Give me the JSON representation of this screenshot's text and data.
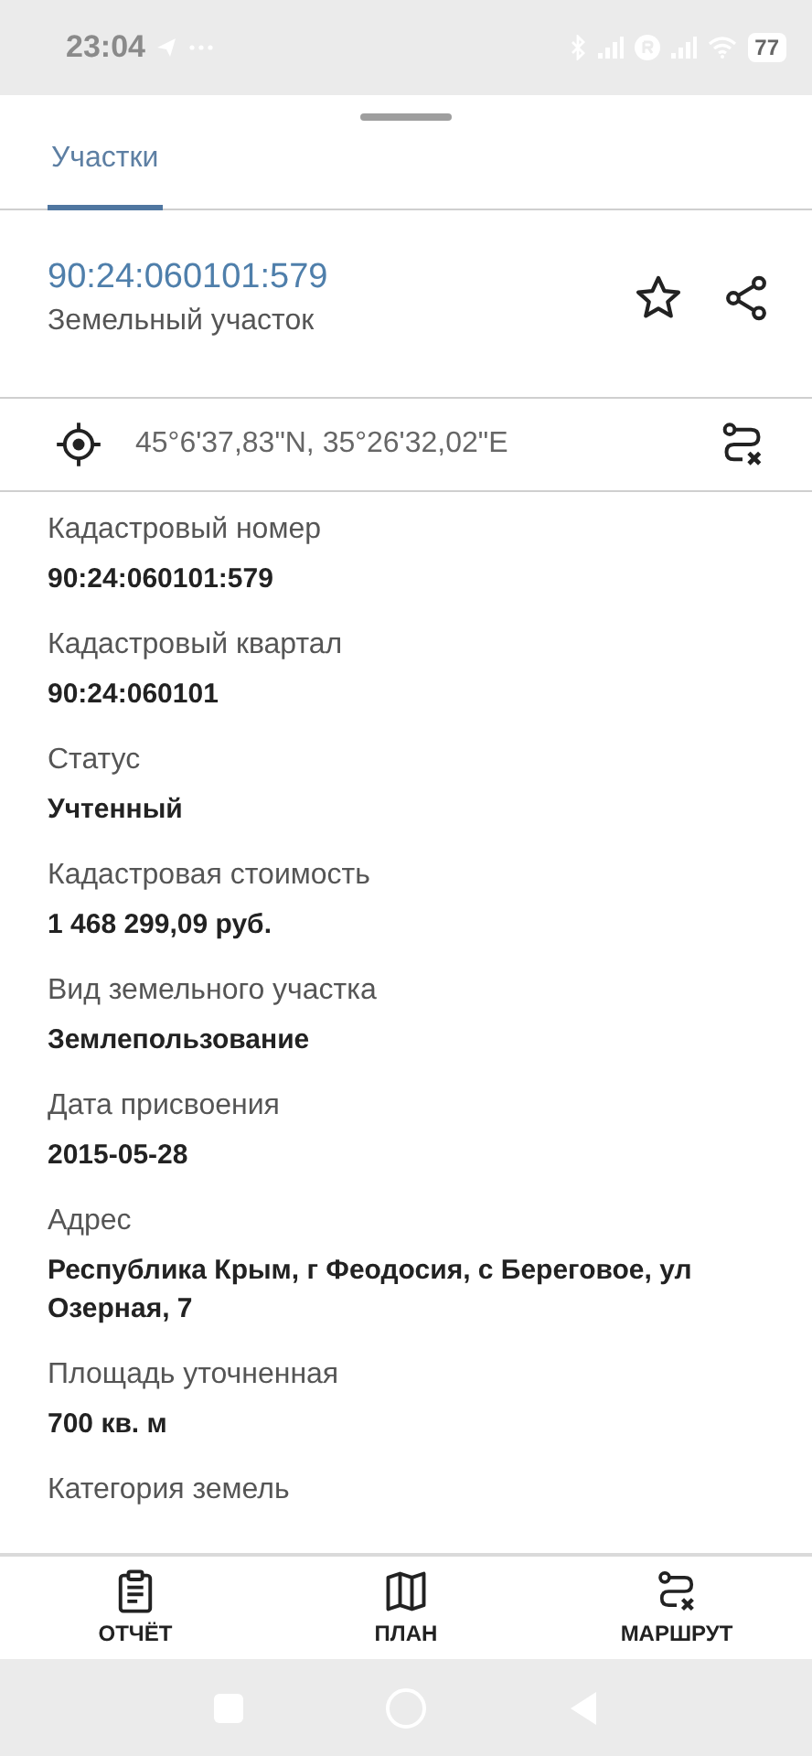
{
  "status_bar": {
    "time": "23:04",
    "battery": "77"
  },
  "tabs": [
    {
      "label": "Участки",
      "selected": true
    }
  ],
  "parcel": {
    "number": "90:24:060101:579",
    "type": "Земельный участок"
  },
  "coordinates": "45°6'37,83\"N, 35°26'32,02\"E",
  "fields": [
    {
      "label": "Кадастровый номер",
      "value": "90:24:060101:579"
    },
    {
      "label": "Кадастровый квартал",
      "value": "90:24:060101"
    },
    {
      "label": "Статус",
      "value": "Учтенный"
    },
    {
      "label": "Кадастровая стоимость",
      "value": "1 468 299,09 руб."
    },
    {
      "label": "Вид земельного участка",
      "value": "Землепользование"
    },
    {
      "label": "Дата присвоения",
      "value": "2015-05-28"
    },
    {
      "label": "Адрес",
      "value": "Республика Крым, г Феодосия, с Береговое, ул Озерная, 7"
    },
    {
      "label": "Площадь уточненная",
      "value": "700 кв. м"
    },
    {
      "label": "Категория земель"
    }
  ],
  "bottom_nav": [
    {
      "kind": "report",
      "label": "ОТЧЁТ"
    },
    {
      "kind": "plan",
      "label": "ПЛАН"
    },
    {
      "kind": "route",
      "label": "МАРШРУТ"
    }
  ]
}
